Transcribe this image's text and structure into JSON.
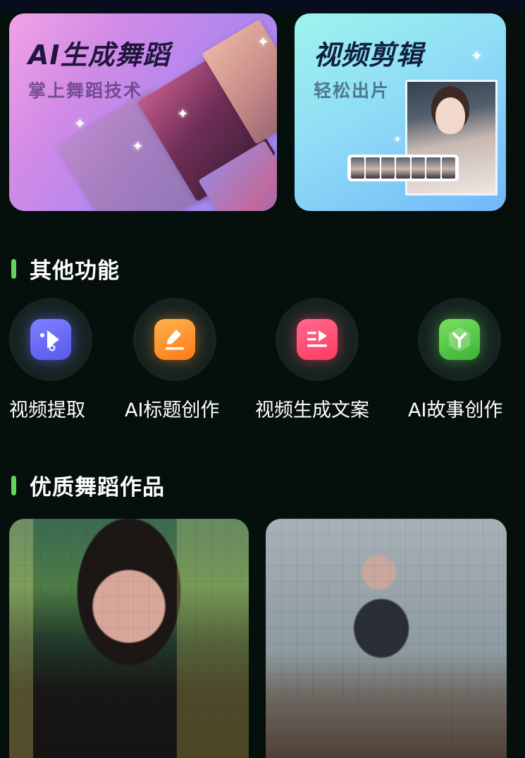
{
  "cards": {
    "dance": {
      "title": "AI生成舞蹈",
      "subtitle": "掌上舞蹈技术"
    },
    "video": {
      "title": "视频剪辑",
      "subtitle": "轻松出片"
    }
  },
  "sections": {
    "other_functions": {
      "title": "其他功能"
    },
    "quality_works": {
      "title": "优质舞蹈作品"
    }
  },
  "functions": [
    {
      "label": "视频提取",
      "icon": "play-extract-icon",
      "color": "#6a6cf7"
    },
    {
      "label": "AI标题创作",
      "icon": "pencil-edit-icon",
      "color": "#ff8a25"
    },
    {
      "label": "视频生成文案",
      "icon": "text-play-icon",
      "color": "#ff4b70"
    },
    {
      "label": "AI故事创作",
      "icon": "cube-y-icon",
      "color": "#52c446"
    }
  ],
  "works": [
    {
      "name": "dance-work-1"
    },
    {
      "name": "dance-work-2"
    }
  ],
  "theme": {
    "background": "#050f0c",
    "accent": "#5fd45d"
  }
}
